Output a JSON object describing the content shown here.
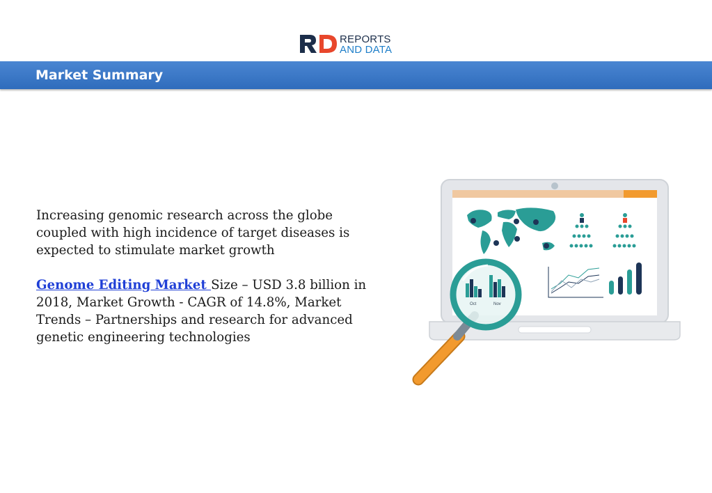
{
  "logo": {
    "line1": "REPORTS",
    "line2": "AND DATA",
    "mark": "RD"
  },
  "header": {
    "title": "Market Summary"
  },
  "summary": {
    "paragraph1": "Increasing genomic research across the globe coupled with high incidence of target diseases is expected to stimulate market growth",
    "link_text": "Genome Editing Market ",
    "paragraph2_rest": "Size – USD 3.8 billion in 2018, Market Growth - CAGR of 14.8%, Market Trends – Partnerships and research for advanced genetic engineering technologies"
  },
  "illustration": {
    "icon": "laptop-analytics-magnifier-icon",
    "lens_labels": [
      "Oct",
      "Nov"
    ],
    "colors": {
      "teal": "#2a9d96",
      "orange": "#f29a2e",
      "navy": "#1d3557",
      "screen_bar": "#f0a040"
    }
  }
}
